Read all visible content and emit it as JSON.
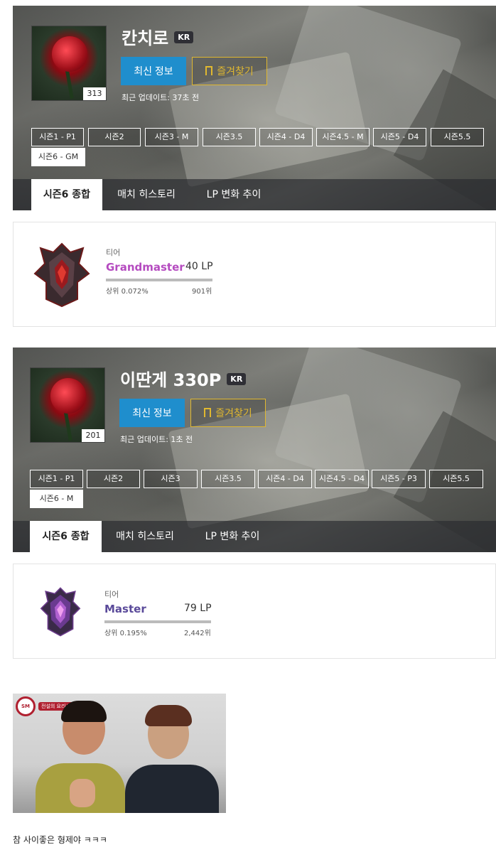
{
  "profiles": [
    {
      "name": "칸치로",
      "region": "KR",
      "level": "313",
      "refresh_label": "최신 정보",
      "favorite_label": "즐겨찾기",
      "updated": "최근 업데이트: 37초 전",
      "seasons": [
        "시즌1 - P1",
        "시즌2",
        "시즌3 - M",
        "시즌3.5",
        "시즌4 - D4",
        "시즌4.5 - M",
        "시즌5 - D4",
        "시즌5.5",
        "시즌6 - GM"
      ],
      "active_season_index": 8,
      "tabs": [
        "시즌6 종합",
        "매치 히스토리",
        "LP 변화 추이"
      ],
      "tier": {
        "label": "티어",
        "name": "Grandmaster",
        "name_color": "#b54bc0",
        "lp": "40 LP",
        "percentile": "상위 0.072%",
        "rank": "901위",
        "progress": 1.0
      }
    },
    {
      "name": "이딴게 330P",
      "region": "KR",
      "level": "201",
      "refresh_label": "최신 정보",
      "favorite_label": "즐겨찾기",
      "updated": "최근 업데이트: 1초 전",
      "seasons": [
        "시즌1 - P1",
        "시즌2",
        "시즌3",
        "시즌3.5",
        "시즌4 - D4",
        "시즌4.5 - D4",
        "시즌5 - P3",
        "시즌5.5",
        "시즌6 - M"
      ],
      "active_season_index": 8,
      "tabs": [
        "시즌6 종합",
        "매치 히스토리",
        "LP 변화 추이"
      ],
      "tier": {
        "label": "티어",
        "name": "Master",
        "name_color": "#5a4a9a",
        "lp": "79 LP",
        "percentile": "상위 0.195%",
        "rank": "2,442위",
        "progress": 1.0
      }
    }
  ],
  "photo": {
    "logo_text": "SM",
    "tag_text": "전설의 요리사"
  },
  "caption": "참 사이좋은 형제야 ㅋㅋㅋ",
  "colors": {
    "accent_blue": "#1f8ecd",
    "favorite_gold": "#e0b830"
  }
}
